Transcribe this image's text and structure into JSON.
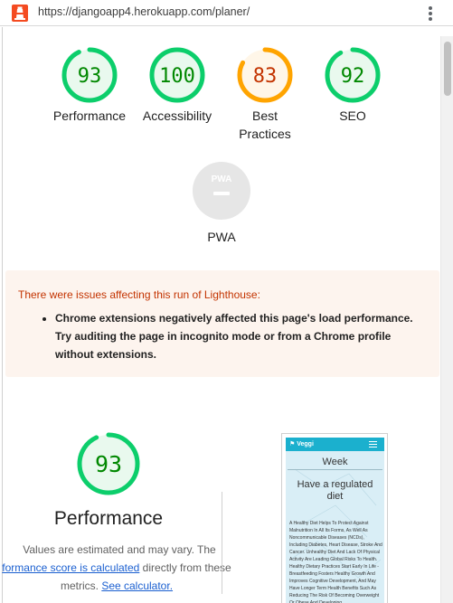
{
  "browser": {
    "url": "https://djangoapp4.herokuapp.com/planer/",
    "icons": {
      "site": "lighthouse-icon",
      "menu": "kebab-menu-icon"
    }
  },
  "colors": {
    "pass": "#0cce6b",
    "pass_text": "#008800",
    "pass_bg": "#e9f9ee",
    "average": "#ffa400",
    "average_text": "#c33300",
    "average_bg": "#fff6e8",
    "pwa_bg": "#e8e8e8",
    "warning_text": "#c33300"
  },
  "scores": [
    {
      "label": "Performance",
      "value": "93",
      "fraction": 0.93,
      "status": "pass"
    },
    {
      "label": "Accessibility",
      "value": "100",
      "fraction": 1.0,
      "status": "pass"
    },
    {
      "label": "Best Practices",
      "value": "83",
      "fraction": 0.83,
      "status": "average"
    },
    {
      "label": "SEO",
      "value": "92",
      "fraction": 0.92,
      "status": "pass"
    }
  ],
  "pwa": {
    "label": "PWA",
    "badge_text": "PWA"
  },
  "warning": {
    "title": "There were issues affecting this run of Lighthouse:",
    "items": [
      "Chrome extensions negatively affected this page's load performance. Try auditing the page in incognito mode or from a Chrome profile without extensions."
    ]
  },
  "performance": {
    "score": "93",
    "fraction": 0.93,
    "title": "Performance",
    "desc_line1": "Values are estimated and may vary. The",
    "desc_link1": "formance score is calculated",
    "desc_line2_rest": " directly from these",
    "desc_line3_pre": "metrics. ",
    "desc_link2": "See calculator."
  },
  "screenshot": {
    "brand": "Veggi",
    "week_label": "Week",
    "heading": "Have a regulated diet",
    "body": "A Healthy Diet Helps To Protect Against Malnutrition In All Its Forms, As Well As Noncommunicable Diseases (NCDs), Including Diabetes, Heart Disease, Stroke And Cancer. Unhealthy Diet And Lack Of Physical Activity Are Leading Global Risks To Health. Healthy Dietary Practices Start Early In Life - Breastfeeding Fosters Healthy Growth And Improves Cognitive Development, And May Have Longer Term Health Benefits Such As Reducing The Risk Of Becoming Overweight Or Obese And Developing"
  }
}
